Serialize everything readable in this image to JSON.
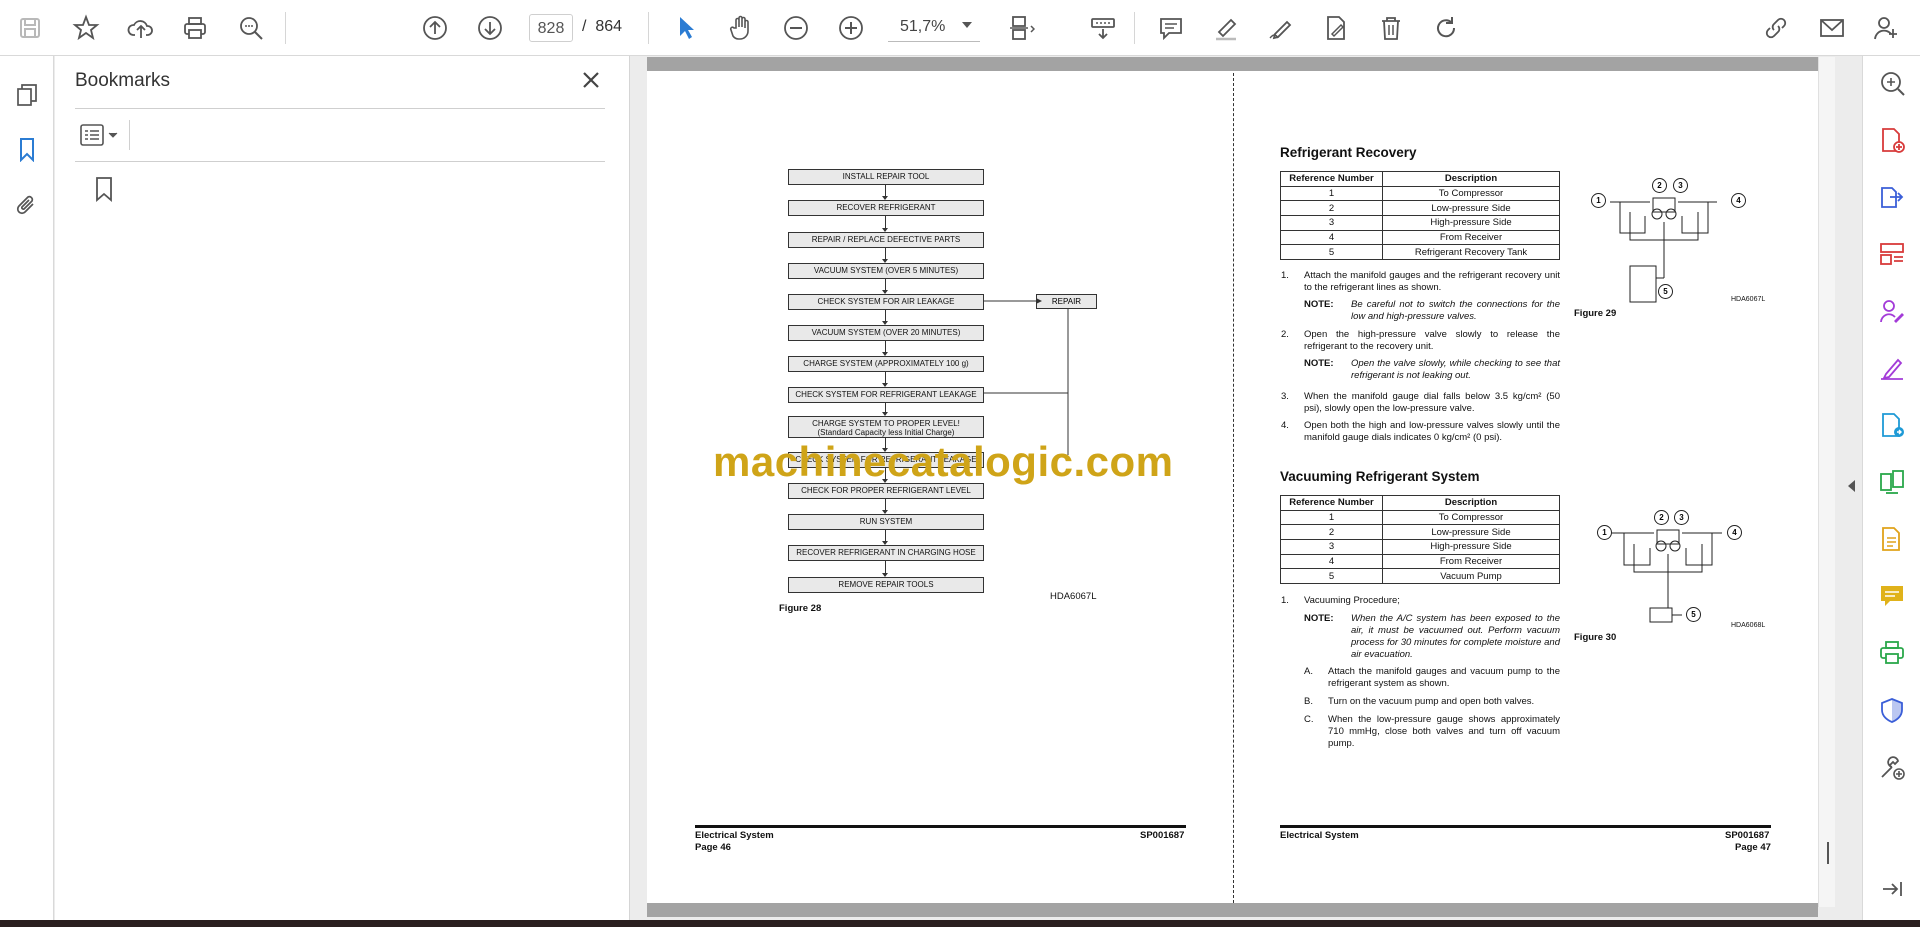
{
  "toolbar": {
    "page_current": "828",
    "page_separator": "/",
    "page_total": "864",
    "zoom": "51,7%"
  },
  "bookmarks": {
    "title": "Bookmarks"
  },
  "watermark": "machinecatalogic.com",
  "left_page": {
    "flow_steps": [
      "INSTALL REPAIR TOOL",
      "RECOVER REFRIGERANT",
      "REPAIR / REPLACE DEFECTIVE PARTS",
      "VACUUM SYSTEM (OVER 5 MINUTES)",
      "CHECK SYSTEM FOR AIR LEAKAGE",
      "VACUUM SYSTEM (OVER 20 MINUTES)",
      "CHARGE SYSTEM (APPROXIMATELY 100 g)",
      "CHECK SYSTEM FOR REFRIGERANT LEAKAGE",
      "CHARGE SYSTEM TO PROPER LEVEL!",
      "CHECK SYSTEM FOR REFRIGERANT LEAKAGE",
      "CHECK FOR PROPER REFRIGERANT LEVEL",
      "RUN SYSTEM",
      "RECOVER REFRIGERANT IN CHARGING HOSE",
      "REMOVE REPAIR TOOLS"
    ],
    "flow_step9_sub": "(Standard Capacity less Initial Charge)",
    "repair_label": "REPAIR",
    "figure_code": "HDA6067L",
    "figure_caption": "Figure 28",
    "footer_section": "Electrical System",
    "footer_doc": "SP001687",
    "footer_page": "Page 46"
  },
  "right_page": {
    "recovery": {
      "title": "Refrigerant Recovery",
      "col_ref": "Reference Number",
      "col_desc": "Description",
      "rows": [
        [
          "1",
          "To Compressor"
        ],
        [
          "2",
          "Low-pressure Side"
        ],
        [
          "3",
          "High-pressure Side"
        ],
        [
          "4",
          "From Receiver"
        ],
        [
          "5",
          "Refrigerant Recovery Tank"
        ]
      ],
      "step1_num": "1.",
      "step1": "Attach the manifold gauges and the refrigerant recovery unit to the refrigerant lines as shown.",
      "note_label": "NOTE:",
      "note1": "Be careful not to switch the connections for the low and high-pressure valves.",
      "step2_num": "2.",
      "step2": "Open the high-pressure valve slowly to release the refrigerant to the recovery unit.",
      "note2": "Open the valve slowly, while checking to see that refrigerant is not leaking out.",
      "step3_num": "3.",
      "step3": "When the manifold gauge dial falls below 3.5 kg/cm² (50 psi), slowly open the low-pressure valve.",
      "step4_num": "4.",
      "step4": "Open both the high and low-pressure valves slowly until the manifold gauge dials indicates 0 kg/cm² (0 psi).",
      "figure_code": "HDA6067L",
      "figure_caption": "Figure 29"
    },
    "vacuum": {
      "title": "Vacuuming Refrigerant System",
      "col_ref": "Reference Number",
      "col_desc": "Description",
      "rows": [
        [
          "1",
          "To Compressor"
        ],
        [
          "2",
          "Low-pressure Side"
        ],
        [
          "3",
          "High-pressure Side"
        ],
        [
          "4",
          "From Receiver"
        ],
        [
          "5",
          "Vacuum Pump"
        ]
      ],
      "step1_num": "1.",
      "step1": "Vacuuming Procedure;",
      "note_label": "NOTE:",
      "note1": "When the A/C system has been exposed to the air, it must be vacuumed out. Perform vacuum process for 30 minutes for complete moisture and air evacuation.",
      "a_num": "A.",
      "a": "Attach the manifold gauges and vacuum pump to the refrigerant system as shown.",
      "b_num": "B.",
      "b": "Turn on the vacuum pump and open both valves.",
      "c_num": "C.",
      "c": "When the low-pressure gauge shows approximately 710 mmHg, close both valves and turn off vacuum pump.",
      "figure_code": "HDA6068L",
      "figure_caption": "Figure 30"
    },
    "footer_section": "Electrical System",
    "footer_doc": "SP001687",
    "footer_page": "Page 47"
  },
  "diagram_labels": [
    "1",
    "2",
    "3",
    "4",
    "5"
  ]
}
